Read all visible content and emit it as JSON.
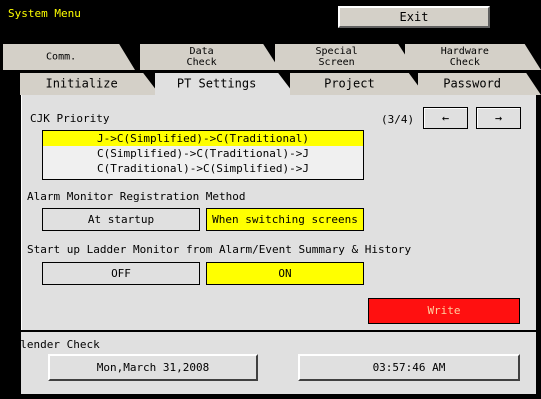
{
  "title": "System Menu",
  "exit_label": "Exit",
  "tabs_row1": [
    {
      "line1": "Comm.",
      "line2": ""
    },
    {
      "line1": "Data",
      "line2": "Check"
    },
    {
      "line1": "Special",
      "line2": "Screen"
    },
    {
      "line1": "Hardware",
      "line2": "Check"
    }
  ],
  "tabs_row2": [
    {
      "label": "Initialize"
    },
    {
      "label": "PT Settings",
      "active": true
    },
    {
      "label": "Project"
    },
    {
      "label": "Password"
    }
  ],
  "cjk": {
    "label": "CJK Priority",
    "page_indicator": "(3/4)",
    "prev_arrow": "←",
    "next_arrow": "→",
    "options": [
      "J->C(Simplified)->C(Traditional)",
      "C(Simplified)->C(Traditional)->J",
      "C(Traditional)->C(Simplified)->J"
    ],
    "selected_index": 0
  },
  "alarm": {
    "label": "Alarm Monitor Registration Method",
    "option_startup": "At startup",
    "option_switching": "When switching screens",
    "selected": "When switching screens"
  },
  "ladder": {
    "label": "Start up Ladder Monitor from Alarm/Event Summary & History",
    "option_off": "OFF",
    "option_on": "ON",
    "selected": "ON"
  },
  "write_label": "Write",
  "calendar": {
    "label": "Calender Check",
    "date": "Mon,March 31,2008",
    "time": "03:57:46 AM"
  },
  "colors": {
    "background": "#000000",
    "panel": "#e0e0e0",
    "selected": "#ffff00",
    "title_text": "#ffff00",
    "write_button": "#ff1010"
  }
}
